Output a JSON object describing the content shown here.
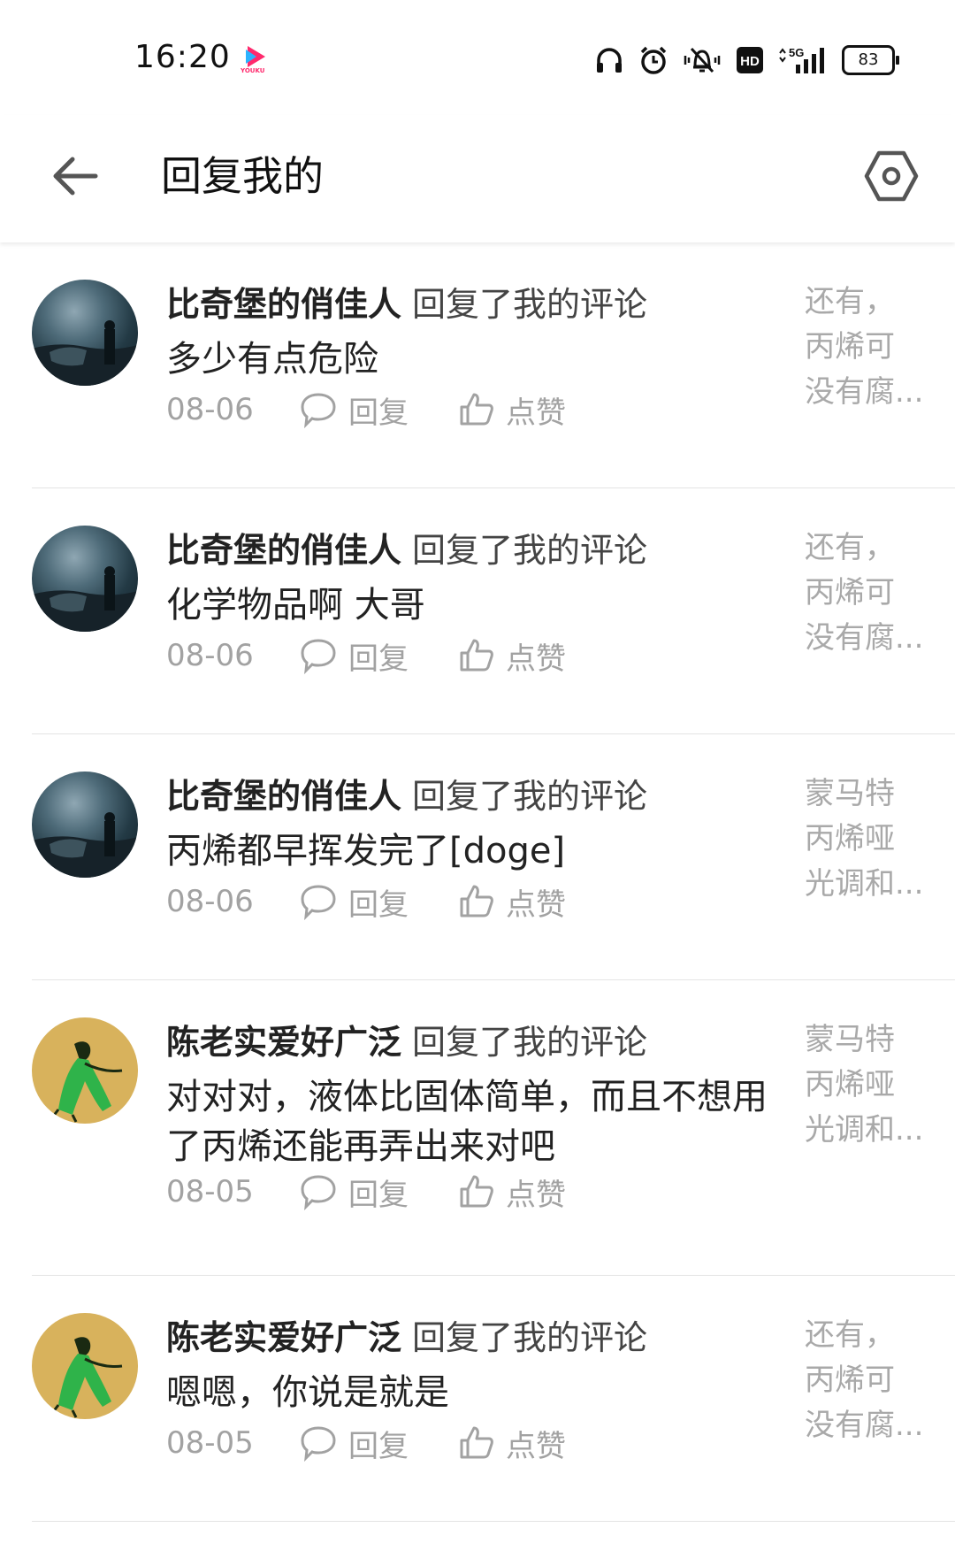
{
  "status": {
    "time": "16:20",
    "youku_label": "YOUKU",
    "hd_label": "HD",
    "network_label": "5G",
    "battery": "83"
  },
  "header": {
    "title": "回复我的"
  },
  "items": [
    {
      "name": "比奇堡的俏佳人",
      "action": "回复了我的评论",
      "content": "多少有点危险",
      "date": "08-06",
      "reply_label": "回复",
      "like_label": "点赞",
      "quote": [
        "还有，",
        "丙烯可",
        "没有腐..."
      ]
    },
    {
      "name": "比奇堡的俏佳人",
      "action": "回复了我的评论",
      "content": "化学物品啊 大哥",
      "date": "08-06",
      "reply_label": "回复",
      "like_label": "点赞",
      "quote": [
        "还有，",
        "丙烯可",
        "没有腐..."
      ]
    },
    {
      "name": "比奇堡的俏佳人",
      "action": "回复了我的评论",
      "content": "丙烯都早挥发完了[doge]",
      "date": "08-06",
      "reply_label": "回复",
      "like_label": "点赞",
      "quote": [
        "蒙马特",
        "丙烯哑",
        "光调和..."
      ]
    },
    {
      "name": "陈老实爱好广泛",
      "action": "回复了我的评论",
      "content": "对对对，液体比固体简单，而且不想用了丙烯还能再弄出来对吧",
      "date": "08-05",
      "reply_label": "回复",
      "like_label": "点赞",
      "quote": [
        "蒙马特",
        "丙烯哑",
        "光调和..."
      ]
    },
    {
      "name": "陈老实爱好广泛",
      "action": "回复了我的评论",
      "content": "嗯嗯，你说是就是",
      "date": "08-05",
      "reply_label": "回复",
      "like_label": "点赞",
      "quote": [
        "还有，",
        "丙烯可",
        "没有腐..."
      ]
    }
  ]
}
